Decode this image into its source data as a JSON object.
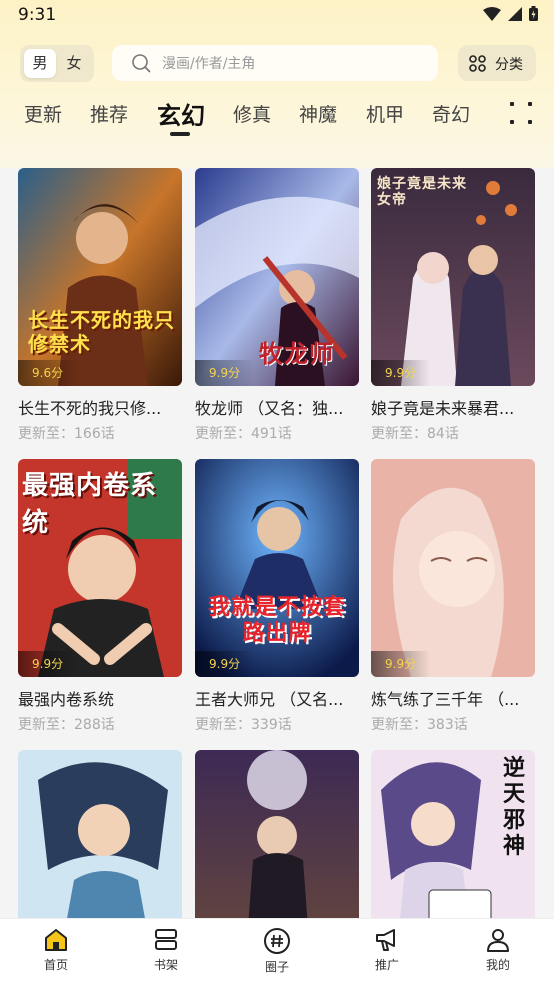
{
  "status": {
    "time": "9:31"
  },
  "header": {
    "gender": {
      "male": "男",
      "female": "女"
    },
    "search": {
      "placeholder": "漫画/作者/主角"
    },
    "classify": {
      "label": "分类",
      "icon": "grid-icon"
    }
  },
  "tabs": [
    "更新",
    "推荐",
    "玄幻",
    "修真",
    "神魔",
    "机甲",
    "奇幻"
  ],
  "active_tab": "玄幻",
  "comics": [
    {
      "title": "长生不死的我只修...",
      "update": "更新至：166话",
      "score": "9.6分",
      "cover_text": "长生不死的我只修禁术",
      "cover_color": "#7b3b1a"
    },
    {
      "title": "牧龙师 （又名：独...",
      "update": "更新至：491话",
      "score": "9.9分",
      "cover_text": "牧龙师",
      "cover_color": "#3a3f7a"
    },
    {
      "title": "娘子竟是未来暴君...",
      "update": "更新至：84话",
      "score": "9.9分",
      "cover_text": "娘子竟是未来女帝",
      "cover_color": "#4a2f4a"
    },
    {
      "title": "最强内卷系统",
      "update": "更新至：288话",
      "score": "9.9分",
      "cover_text": "最强内卷系统",
      "cover_color": "#b8332b"
    },
    {
      "title": "王者大师兄 （又名...",
      "update": "更新至：339话",
      "score": "9.9分",
      "cover_text": "我就是不按套路出牌",
      "cover_color": "#1d3f8a"
    },
    {
      "title": "炼气练了三千年 （...",
      "update": "更新至：383话",
      "score": "9.9分",
      "cover_text": "",
      "cover_color": "#e7b7ad"
    },
    {
      "title": "",
      "update": "",
      "score": "",
      "cover_text": "",
      "cover_color": "#5f8fb6"
    },
    {
      "title": "",
      "update": "",
      "score": "",
      "cover_text": "",
      "cover_color": "#4a2e52"
    },
    {
      "title": "",
      "update": "",
      "score": "",
      "cover_text": "逆天邪神",
      "cover_color": "#e9d7e6"
    }
  ],
  "bottom_nav": [
    {
      "label": "首页",
      "icon": "home-icon",
      "active": true
    },
    {
      "label": "书架",
      "icon": "bookshelf-icon",
      "active": false
    },
    {
      "label": "圈子",
      "icon": "hashtag-icon",
      "active": false
    },
    {
      "label": "推广",
      "icon": "megaphone-icon",
      "active": false
    },
    {
      "label": "我的",
      "icon": "profile-icon",
      "active": false
    }
  ],
  "colors": {
    "accent": "#f5c518",
    "score": "#f4d44d",
    "header_bg": "#fdf2c6"
  }
}
